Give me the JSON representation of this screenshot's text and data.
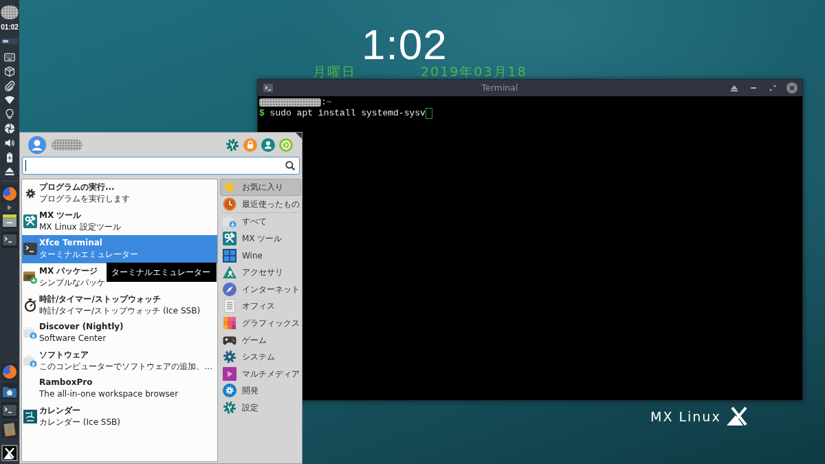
{
  "panel": {
    "clock": "01:02"
  },
  "desktop_clock": {
    "time": "1:02",
    "weekday": "月曜日",
    "date": "2019年03月18"
  },
  "terminal": {
    "title": "Terminal",
    "prompt_separator": ":",
    "prompt_path": "~",
    "prompt_symbol": "$",
    "command": "sudo apt install systemd-sysv"
  },
  "menu": {
    "items": [
      {
        "title": "プログラムの実行...",
        "subtitle": "プログラムを実行します",
        "selected": false
      },
      {
        "title": "MX ツール",
        "subtitle": "MX Linux 設定ツール",
        "selected": false
      },
      {
        "title": "Xfce Terminal",
        "subtitle": "ターミナルエミュレーター",
        "selected": true
      },
      {
        "title": "MX パッケージ",
        "subtitle": "シンプルなパッケ",
        "selected": false
      },
      {
        "title": "時計/タイマー/ストップウォッチ",
        "subtitle": "時計/タイマー/ストップウォッチ (Ice SSB)",
        "selected": false
      },
      {
        "title": "Discover (Nightly)",
        "subtitle": "Software Center",
        "selected": false
      },
      {
        "title": "ソフトウェア",
        "subtitle": "このコンピューターでソフトウェアの追加、…",
        "selected": false
      },
      {
        "title": "RamboxPro",
        "subtitle": "The all-in-one workspace browser",
        "selected": false
      },
      {
        "title": "カレンダー",
        "subtitle": "カレンダー (Ice SSB)",
        "selected": false
      }
    ],
    "tooltip": "ターミナルエミュレーター",
    "categories": [
      {
        "label": "お気に入り",
        "selected": true
      },
      {
        "label": "最近使ったもの",
        "selected": false
      },
      {
        "label": "すべて",
        "selected": false
      },
      {
        "label": "MX ツール",
        "selected": false
      },
      {
        "label": "Wine",
        "selected": false
      },
      {
        "label": "アクセサリ",
        "selected": false
      },
      {
        "label": "インターネット",
        "selected": false
      },
      {
        "label": "オフィス",
        "selected": false
      },
      {
        "label": "グラフィックス",
        "selected": false
      },
      {
        "label": "ゲーム",
        "selected": false
      },
      {
        "label": "システム",
        "selected": false
      },
      {
        "label": "マルチメディア",
        "selected": false
      },
      {
        "label": "開発",
        "selected": false
      },
      {
        "label": "設定",
        "selected": false
      }
    ]
  },
  "logo": {
    "text": "MX Linux"
  }
}
